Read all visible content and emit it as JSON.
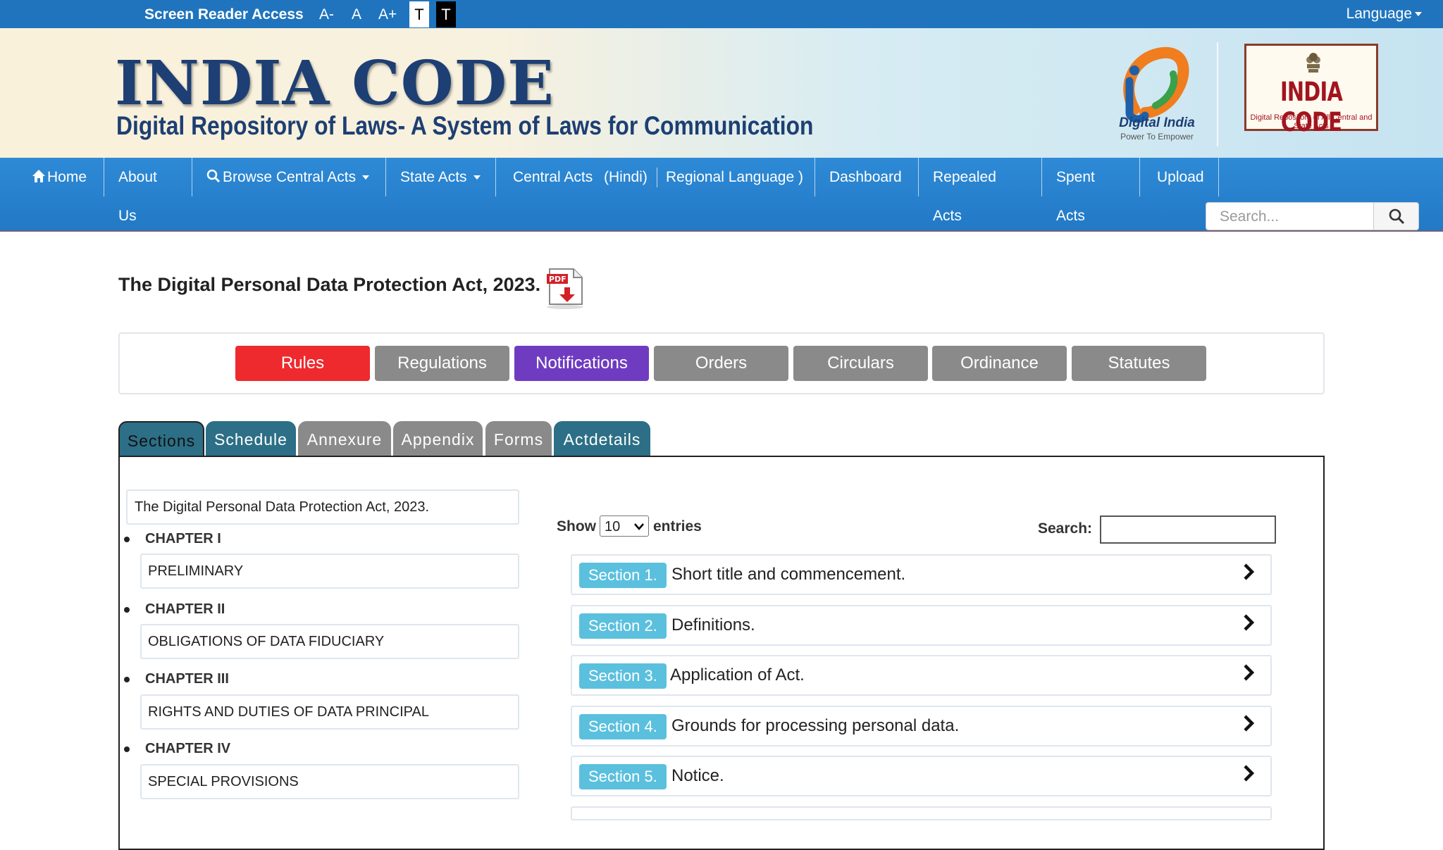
{
  "topbar": {
    "screen_reader": "Screen Reader Access",
    "font_sizes": [
      "A-",
      "A",
      "A+"
    ],
    "theme_light": "T",
    "theme_dark": "T",
    "language": "Language"
  },
  "banner": {
    "title": "INDIA CODE",
    "subtitle": "Digital Repository of Laws- A System of Laws for Communication",
    "digital_india": "Digital India",
    "digital_india_tagline": "Power To Empower",
    "badge_title": "INDIA CODE",
    "badge_subtitle": "Digital Repository of All Central and State Acts"
  },
  "nav": {
    "items": [
      {
        "label": "Home",
        "icon": "home-icon"
      },
      {
        "label": "About Us"
      },
      {
        "label": "Browse Central Acts",
        "icon": "search-icon",
        "dropdown": true
      },
      {
        "label": "State Acts",
        "dropdown": true
      },
      {
        "label": "Central Acts"
      },
      {
        "label": "(Hindi)"
      },
      {
        "label": "Regional Language )"
      },
      {
        "label": "Dashboard"
      },
      {
        "label": "Repealed Acts"
      },
      {
        "label": "Spent Acts"
      },
      {
        "label": "Upload"
      }
    ],
    "search_placeholder": "Search..."
  },
  "page": {
    "title": "The Digital Personal Data Protection Act, 2023.",
    "pdf_icon": "pdf-download-icon"
  },
  "categories": [
    {
      "label": "Rules",
      "color": "#ee2a2e"
    },
    {
      "label": "Regulations",
      "color": "#8a8a8a"
    },
    {
      "label": "Notifications",
      "color": "#6f3cc1"
    },
    {
      "label": "Orders",
      "color": "#8a8a8a"
    },
    {
      "label": "Circulars",
      "color": "#8a8a8a"
    },
    {
      "label": "Ordinance",
      "color": "#8a8a8a"
    },
    {
      "label": "Statutes",
      "color": "#8a8a8a"
    }
  ],
  "tabs": [
    {
      "label": "Sections",
      "active": true
    },
    {
      "label": "Schedule"
    },
    {
      "label": "Annexure"
    },
    {
      "label": "Appendix"
    },
    {
      "label": "Forms"
    },
    {
      "label": "Actdetails"
    }
  ],
  "toc": {
    "act_name": "The Digital Personal Data Protection Act, 2023.",
    "chapters": [
      {
        "label": "CHAPTER I",
        "title": "PRELIMINARY"
      },
      {
        "label": "CHAPTER II",
        "title": "OBLIGATIONS OF DATA FIDUCIARY"
      },
      {
        "label": "CHAPTER III",
        "title": "RIGHTS AND DUTIES OF DATA PRINCIPAL"
      },
      {
        "label": "CHAPTER IV",
        "title": "SPECIAL PROVISIONS"
      }
    ]
  },
  "list": {
    "show_label": "Show",
    "entries_value": "10",
    "entries_label": "entries",
    "search_label": "Search:",
    "sections": [
      {
        "badge": "Section 1.",
        "title": "Short title and commencement."
      },
      {
        "badge": "Section 2.",
        "title": "Definitions."
      },
      {
        "badge": "Section 3.",
        "title": "Application of Act."
      },
      {
        "badge": "Section 4.",
        "title": "Grounds for processing personal data."
      },
      {
        "badge": "Section 5.",
        "title": "Notice."
      }
    ]
  }
}
